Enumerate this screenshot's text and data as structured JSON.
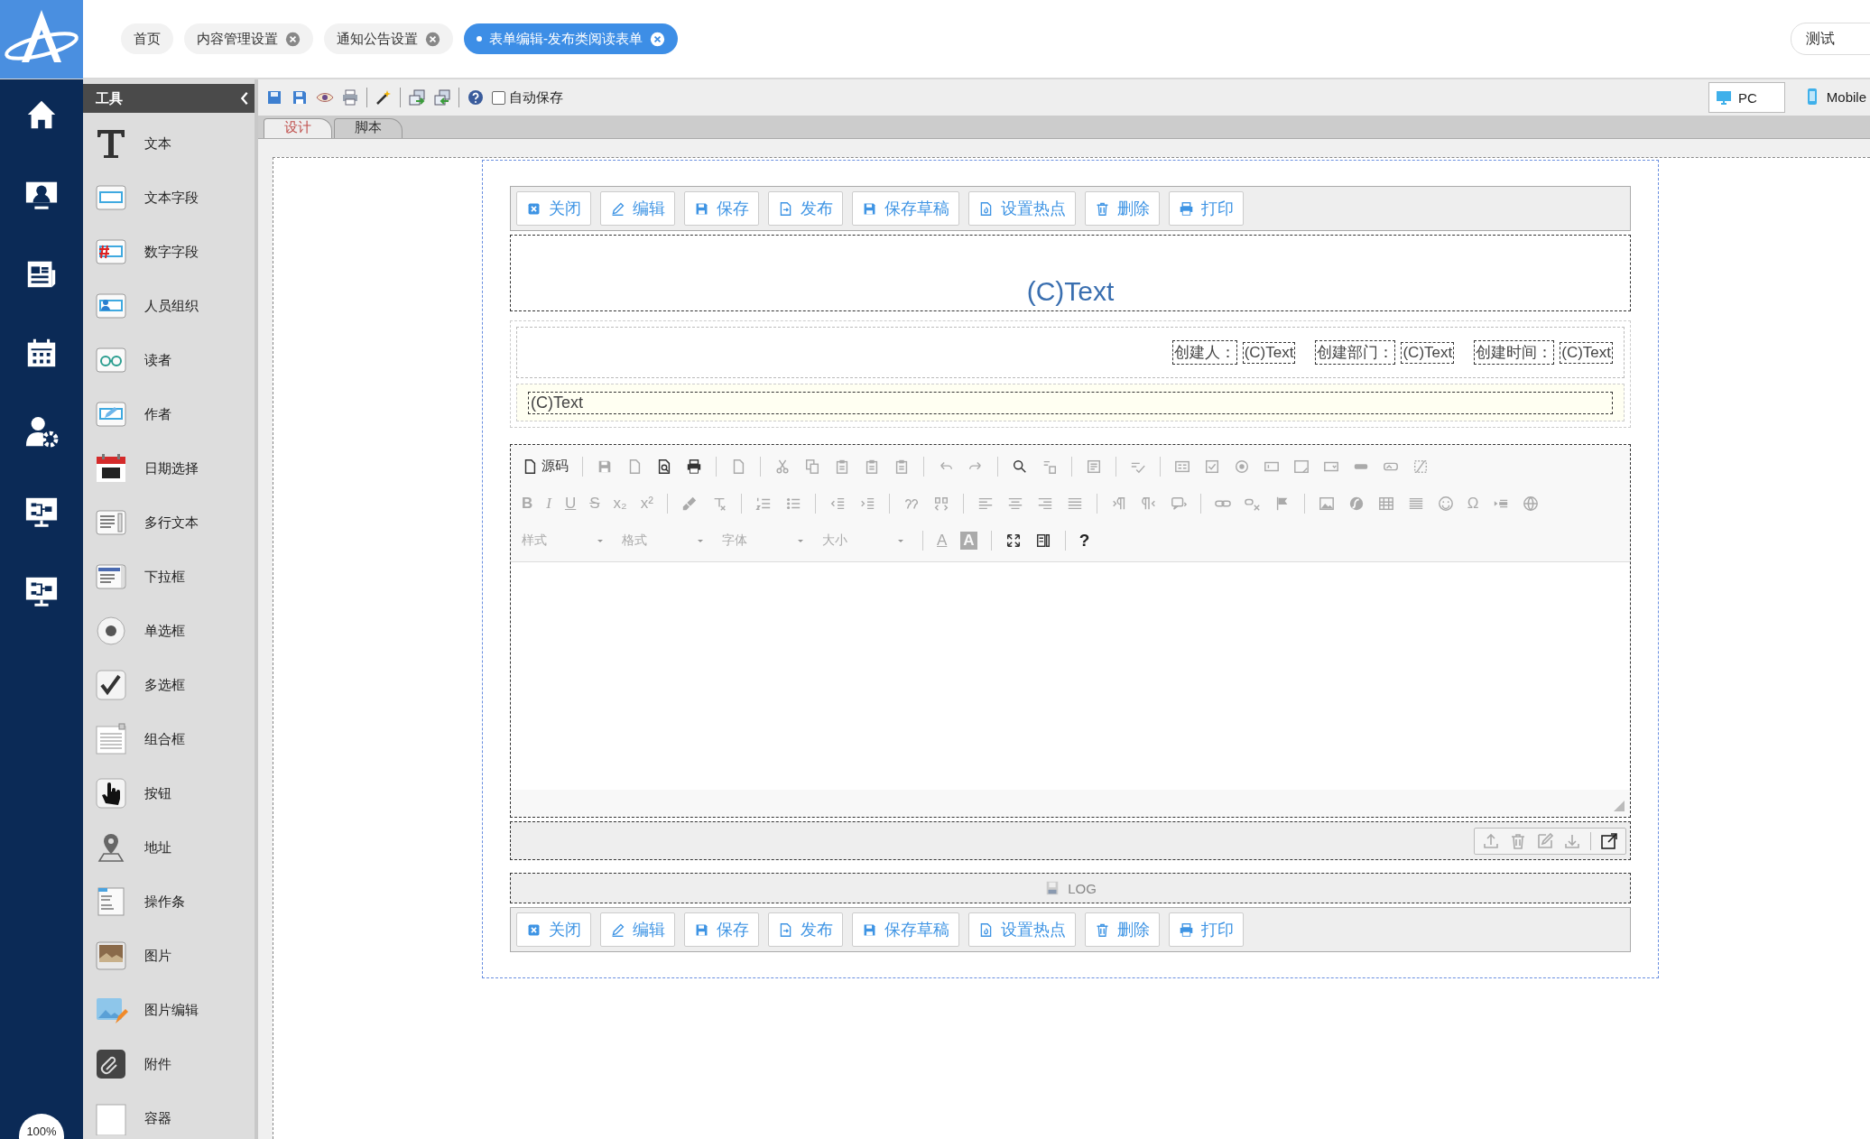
{
  "header": {
    "tabs": [
      {
        "label": "首页",
        "closable": false,
        "selected": false
      },
      {
        "label": "内容管理设置",
        "closable": true,
        "selected": false
      },
      {
        "label": "通知公告设置",
        "closable": true,
        "selected": false
      },
      {
        "label": "表单编辑-发布类阅读表单",
        "closable": true,
        "selected": true
      }
    ],
    "user_field": "测试"
  },
  "nav": {
    "zoom_badge": "100%"
  },
  "tools": {
    "title": "工具",
    "items": [
      "文本",
      "文本字段",
      "数字字段",
      "人员组织",
      "读者",
      "作者",
      "日期选择",
      "多行文本",
      "下拉框",
      "单选框",
      "多选框",
      "组合框",
      "按钮",
      "地址",
      "操作条",
      "图片",
      "图片编辑",
      "附件",
      "容器"
    ]
  },
  "designer": {
    "autosave": {
      "label": "自动保存",
      "checked": false
    },
    "views": [
      {
        "label": "PC",
        "selected": true
      },
      {
        "label": "Mobile",
        "selected": false
      }
    ],
    "tabs": [
      {
        "label": "设计",
        "selected": true
      },
      {
        "label": "脚本",
        "selected": false
      }
    ]
  },
  "form": {
    "top_actions": [
      {
        "kind": "close",
        "label": "关闭"
      },
      {
        "kind": "edit",
        "label": "编辑"
      },
      {
        "kind": "save",
        "label": "保存"
      },
      {
        "kind": "publish",
        "label": "发布"
      },
      {
        "kind": "draft",
        "label": "保存草稿"
      },
      {
        "kind": "hotspot",
        "label": "设置热点"
      },
      {
        "kind": "delete",
        "label": "删除"
      },
      {
        "kind": "print",
        "label": "打印"
      }
    ],
    "title": "(C)Text",
    "meta": [
      {
        "label": "创建人：",
        "value": "(C)Text"
      },
      {
        "label": "创建部门：",
        "value": "(C)Text"
      },
      {
        "label": "创建时间：",
        "value": "(C)Text"
      }
    ],
    "subject": "(C)Text",
    "editor": {
      "source": "源码",
      "glyphs": [
        "B",
        "I",
        "U",
        "S",
        "x₂",
        "x²",
        "Ω",
        "A",
        "A",
        "?"
      ],
      "dropdowns": [
        "样式",
        "格式",
        "字体",
        "大小"
      ]
    },
    "log": "LOG",
    "bottom_actions": [
      {
        "kind": "close",
        "label": "关闭"
      },
      {
        "kind": "edit",
        "label": "编辑"
      },
      {
        "kind": "save",
        "label": "保存"
      },
      {
        "kind": "publish",
        "label": "发布"
      },
      {
        "kind": "draft",
        "label": "保存草稿"
      },
      {
        "kind": "hotspot",
        "label": "设置热点"
      },
      {
        "kind": "delete",
        "label": "删除"
      },
      {
        "kind": "print",
        "label": "打印"
      }
    ]
  }
}
